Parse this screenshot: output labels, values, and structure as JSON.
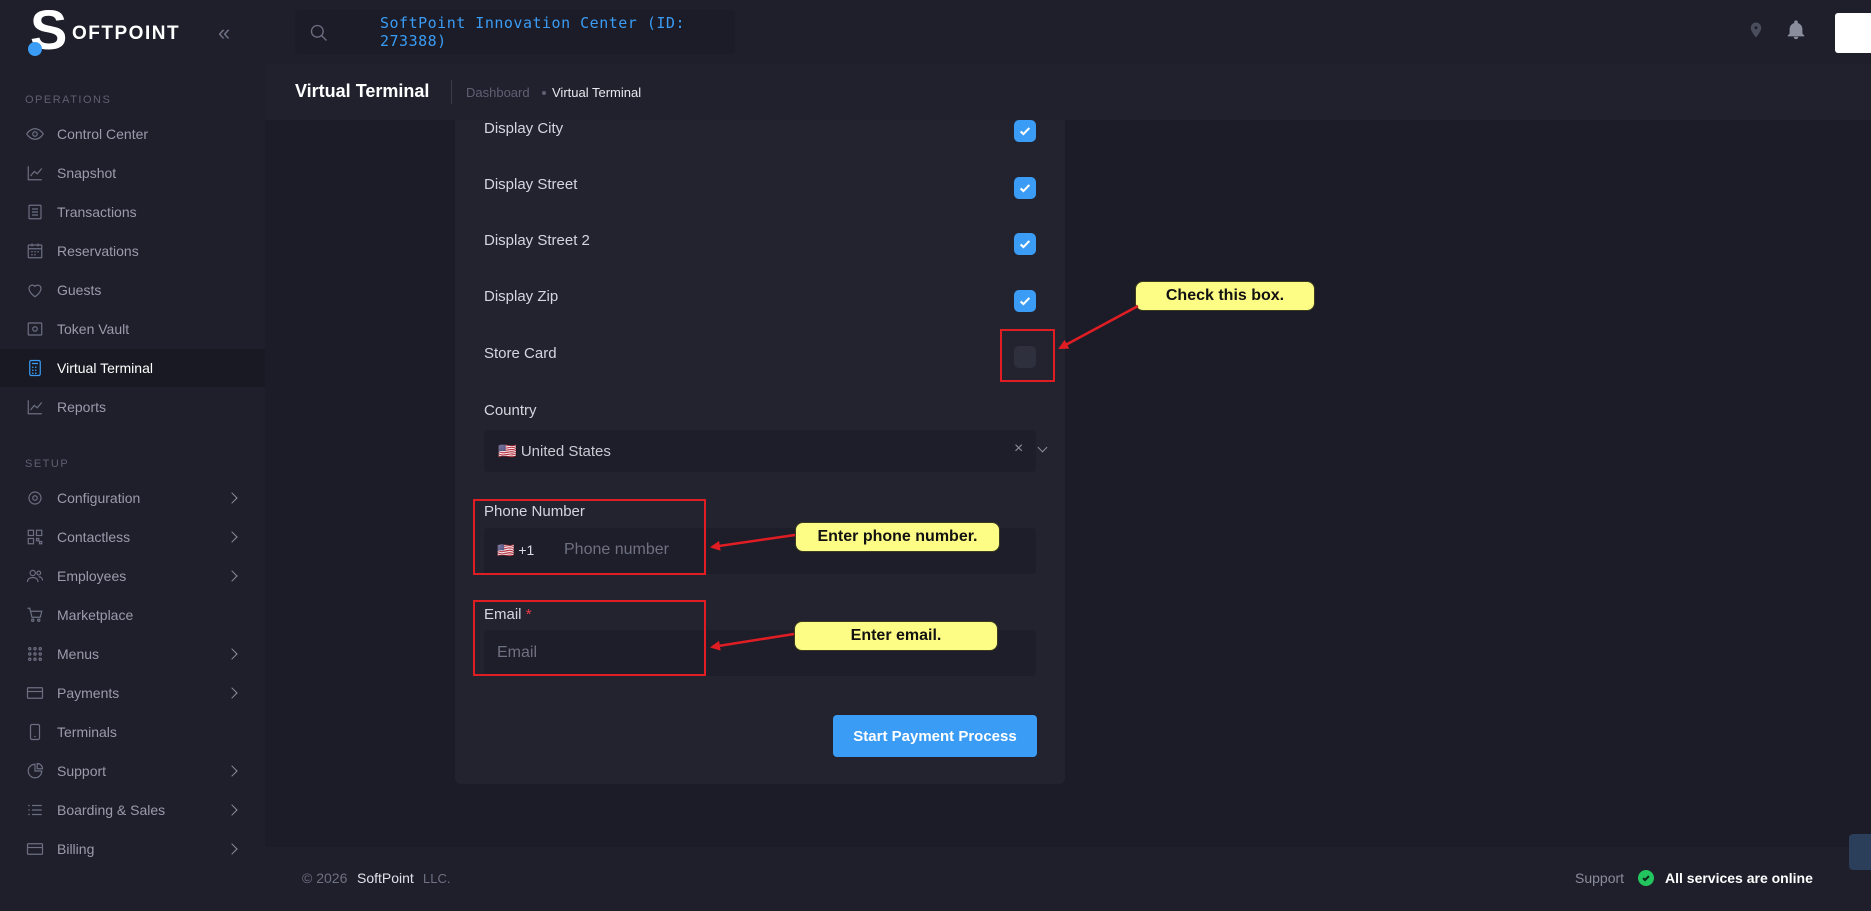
{
  "brand": {
    "logo_letter": "S",
    "logo_text": "OFTPOINT"
  },
  "sidebar": {
    "operations_label": "OPERATIONS",
    "setup_label": "SETUP",
    "operations": [
      {
        "label": "Control Center",
        "icon": "eye-icon"
      },
      {
        "label": "Snapshot",
        "icon": "trend-chart-icon"
      },
      {
        "label": "Transactions",
        "icon": "list-icon"
      },
      {
        "label": "Reservations",
        "icon": "calendar-icon"
      },
      {
        "label": "Guests",
        "icon": "heart-icon"
      },
      {
        "label": "Token Vault",
        "icon": "vault-icon"
      },
      {
        "label": "Virtual Terminal",
        "icon": "calculator-icon",
        "active": true
      },
      {
        "label": "Reports",
        "icon": "trend-chart-icon"
      }
    ],
    "setup": [
      {
        "label": "Configuration",
        "icon": "gear-icon",
        "has_children": true
      },
      {
        "label": "Contactless",
        "icon": "qr-icon",
        "has_children": true
      },
      {
        "label": "Employees",
        "icon": "users-icon",
        "has_children": true
      },
      {
        "label": "Marketplace",
        "icon": "cart-icon",
        "has_children": false
      },
      {
        "label": "Menus",
        "icon": "grid-dots-icon",
        "has_children": true
      },
      {
        "label": "Payments",
        "icon": "card-icon",
        "has_children": true
      },
      {
        "label": "Terminals",
        "icon": "tablet-icon",
        "has_children": false
      },
      {
        "label": "Support",
        "icon": "pie-icon",
        "has_children": true
      },
      {
        "label": "Boarding & Sales",
        "icon": "checklist-icon",
        "has_children": true
      },
      {
        "label": "Billing",
        "icon": "card-icon",
        "has_children": true
      }
    ]
  },
  "header": {
    "location": "SoftPoint Innovation Center (ID: 273388)"
  },
  "subheader": {
    "title": "Virtual Terminal",
    "breadcrumb_home": "Dashboard",
    "breadcrumb_current": "Virtual Terminal"
  },
  "form": {
    "checkboxes": [
      {
        "label": "Display City",
        "checked": true
      },
      {
        "label": "Display Street",
        "checked": true
      },
      {
        "label": "Display Street 2",
        "checked": true
      },
      {
        "label": "Display Zip",
        "checked": true
      },
      {
        "label": "Store Card",
        "checked": false
      }
    ],
    "country_label": "Country",
    "country_value": "🇺🇸 United States",
    "phone_label": "Phone Number",
    "phone_prefix": "🇺🇸 +1",
    "phone_placeholder": "Phone number",
    "email_label": "Email",
    "email_required_mark": "*",
    "email_placeholder": "Email",
    "submit_label": "Start Payment Process"
  },
  "annotations": {
    "check_box": "Check this box.",
    "enter_phone": "Enter phone number.",
    "enter_email": "Enter email."
  },
  "footer": {
    "copyright": "© 2026",
    "company": "SoftPoint",
    "suffix": "LLC.",
    "support": "Support",
    "status": "All services are online"
  },
  "colors": {
    "accent": "#3a9cf5",
    "annotation_red": "#e11d24",
    "callout_yellow": "#fdfd86",
    "status_green": "#22c55e"
  }
}
